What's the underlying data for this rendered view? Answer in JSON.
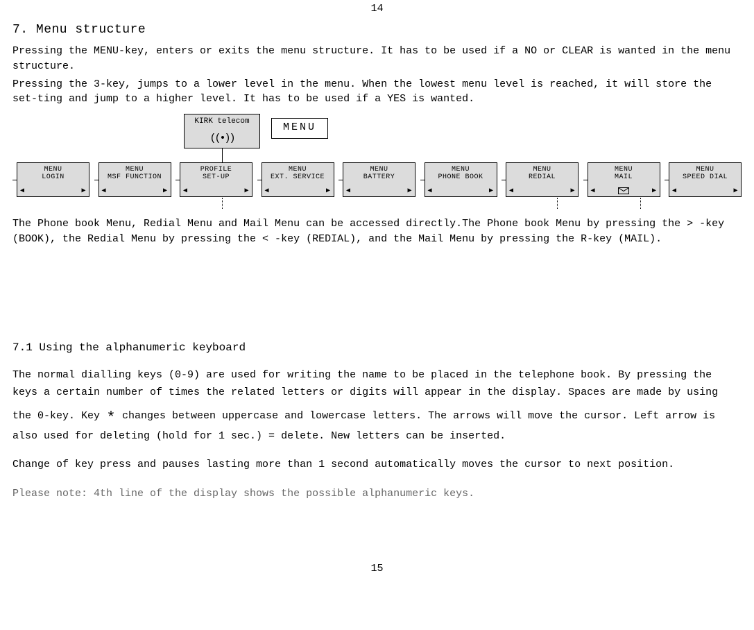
{
  "page_number_top": "14",
  "page_number_bottom": "15",
  "section_title": "7. Menu structure",
  "intro_para1": "Pressing the MENU-key, enters or exits the menu structure. It has to be used if a  NO  or  CLEAR  is wanted in the menu structure.",
  "intro_para2": "Pressing the  3-key, jumps to a lower level in the menu. When the lowest menu level is reached, it will store the set-ting and jump to a higher level. It has to be used if a  YES  is wanted.",
  "kirk_label": "KIRK telecom",
  "menu_label": "MENU",
  "menu_items": [
    {
      "line1": "MENU",
      "line2": "LOGIN"
    },
    {
      "line1": "MENU",
      "line2": "MSF FUNCTION"
    },
    {
      "line1": "PROFILE",
      "line2": "SET-UP"
    },
    {
      "line1": "MENU",
      "line2": "EXT. SERVICE"
    },
    {
      "line1": "MENU",
      "line2": "BATTERY"
    },
    {
      "line1": "MENU",
      "line2": "PHONE BOOK"
    },
    {
      "line1": "MENU",
      "line2": "REDIAL"
    },
    {
      "line1": "MENU",
      "line2": "MAIL"
    },
    {
      "line1": "MENU",
      "line2": "SPEED DIAL"
    }
  ],
  "post_diagram_para": "The Phone book Menu, Redial Menu and Mail Menu can be accessed directly.The Phone book Menu by pressing the > -key (BOOK), the Redial Menu by pressing the < -key (REDIAL), and the Mail Menu by pressing the R-key (MAIL).",
  "section71_title": "7.1 Using the alphanumeric keyboard",
  "p71_a": "The normal dialling keys (0-9) are used for writing the name to be placed in the telephone book. By pressing the keys a certain number of times the related letters or digits will appear in the display. Spaces are made by using the 0-key. Key ",
  "p71_b": " changes between uppercase and lowercase letters. The arrows will move the cursor. Left arrow is also used for deleting (hold for 1 sec.) = delete.  New letters can be inserted.",
  "p71_c": "Change of key press and pauses lasting more than 1 second automatically moves the cursor to next position.",
  "p71_note": "Please note: 4th line of the display shows the possible alphanumeric keys."
}
